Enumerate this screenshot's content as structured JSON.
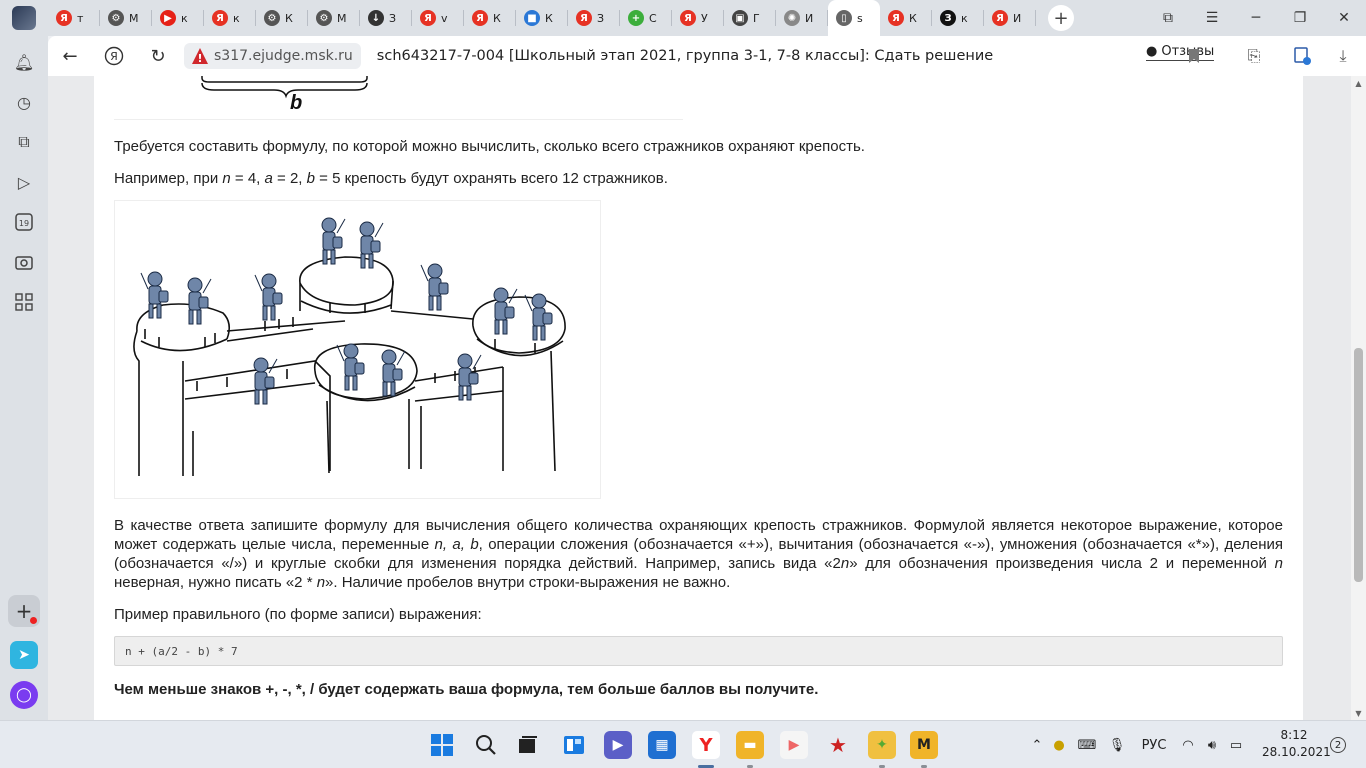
{
  "tabs": [
    {
      "fav": "Я",
      "label": "т",
      "color": "#e63224"
    },
    {
      "fav": "⚙",
      "label": "М",
      "color": "#555555"
    },
    {
      "fav": "▶",
      "label": "к",
      "color": "#e62117"
    },
    {
      "fav": "Я",
      "label": "к",
      "color": "#e63224"
    },
    {
      "fav": "⚙",
      "label": "К",
      "color": "#555555"
    },
    {
      "fav": "⚙",
      "label": "М",
      "color": "#555555"
    },
    {
      "fav": "↓",
      "label": "З",
      "color": "#333333"
    },
    {
      "fav": "Я",
      "label": "v",
      "color": "#e63224"
    },
    {
      "fav": "Я",
      "label": "К",
      "color": "#e63224"
    },
    {
      "fav": "■",
      "label": "К",
      "color": "#2b78d6"
    },
    {
      "fav": "Я",
      "label": "З",
      "color": "#e63224"
    },
    {
      "fav": "+",
      "label": "С",
      "color": "#3cae3c"
    },
    {
      "fav": "Я",
      "label": "У",
      "color": "#e63224"
    },
    {
      "fav": "▣",
      "label": "Г",
      "color": "#444444"
    },
    {
      "fav": "✺",
      "label": "И",
      "color": "#888888"
    },
    {
      "fav": "▯",
      "label": "s",
      "color": "#666666",
      "active": true
    },
    {
      "fav": "Я",
      "label": "К",
      "color": "#e63224"
    },
    {
      "fav": "З",
      "label": "к",
      "color": "#111111"
    },
    {
      "fav": "Я",
      "label": "И",
      "color": "#e63224"
    }
  ],
  "addressbar": {
    "url": "s317.ejudge.msk.ru",
    "title": "sch643217-7-004 [Школьный этап 2021, группа 3-1, 7-8 классы]: Сдать решение",
    "feedback": "Отзывы"
  },
  "figure_top": {
    "label": "b"
  },
  "content": {
    "p1": "Требуется составить формулу, по которой можно вычислить, сколько всего стражников охраняют крепость.",
    "p2": {
      "prefix": "Например, при ",
      "n": "n",
      "n_val": " = 4, ",
      "a": "a",
      "a_val": " = 2, ",
      "b": "b",
      "b_val": " = 5 крепость будут охранять всего 12 стражников."
    },
    "p3": {
      "t1": "В качестве ответа запишите формулу для вычисления общего количества охраняющих крепость стражников. Формулой является некоторое выражение, которое может содержать целые числа, переменные ",
      "vars": "n, a, b",
      "t2": ", операции сложения (обозначается «+»), вычитания (обозначается «-»), умножения (обозначается «*»), деления (обозначается «/») и круглые скобки для изменения порядка действий. Например, запись вида «2",
      "v1": "n",
      "t3": "» для обозначения произведения числа 2 и переменной ",
      "v2": "n",
      "t4": " неверная, нужно писать «2 * ",
      "v3": "n",
      "t5": "». Наличие пробелов внутри строки-выражения не важно."
    },
    "p4": "Пример правильного (по форме записи) выражения:",
    "code": "n + (a/2 - b) * 7",
    "p5": "Чем меньше знаков +, -, *, / будет содержать ваша формула, тем больше баллов вы получите."
  },
  "taskbar": {
    "lang": "РУС",
    "time": "8:12",
    "date": "28.10.2021",
    "notifications": "2"
  }
}
